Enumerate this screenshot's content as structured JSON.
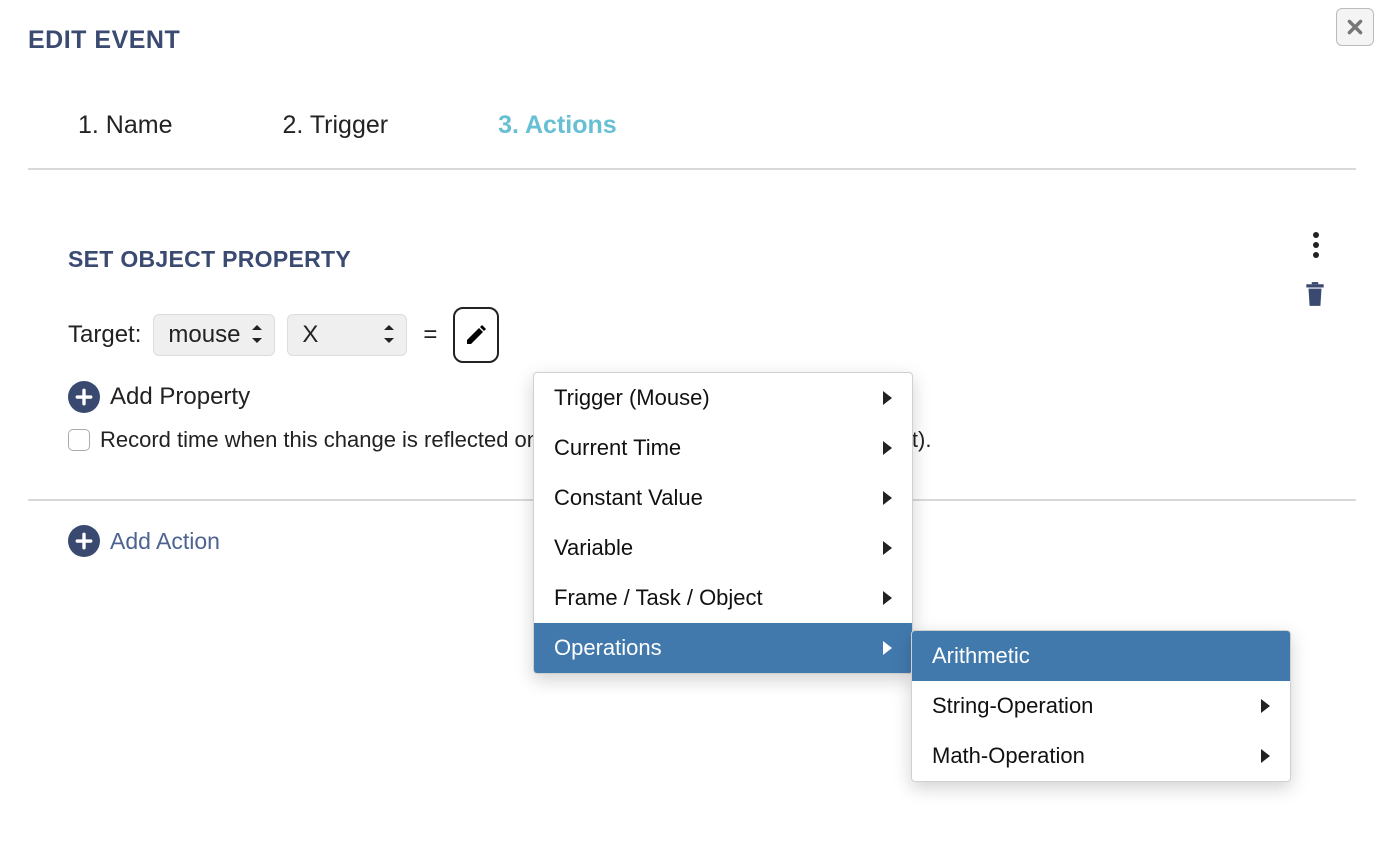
{
  "modalTitle": "EDIT EVENT",
  "steps": [
    {
      "label": "1. Name"
    },
    {
      "label": "2. Trigger"
    },
    {
      "label": "3. Actions"
    }
  ],
  "sectionTitle": "SET OBJECT PROPERTY",
  "target": {
    "label": "Target:",
    "objectSelect": "mouse",
    "propertySelect": "X",
    "equals": "="
  },
  "addProperty": "Add Property",
  "recordTime": "Record time when this change is reflected on-screen (milliseconds from frame onset).",
  "addAction": "Add Action",
  "menu1": {
    "items": [
      "Trigger (Mouse)",
      "Current Time",
      "Constant Value",
      "Variable",
      "Frame / Task / Object",
      "Operations"
    ],
    "highlightIndex": 5
  },
  "menu2": {
    "items": [
      "Arithmetic",
      "String-Operation",
      "Math-Operation"
    ],
    "highlightIndex": 0,
    "noArrowIndex": 0
  }
}
